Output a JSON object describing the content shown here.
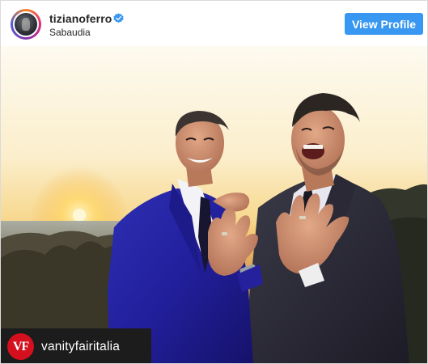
{
  "header": {
    "username": "tizianoferro",
    "location": "Sabaudia",
    "verified_icon": "verified-badge-icon",
    "view_profile_label": "View Profile"
  },
  "photo": {
    "overlay_account": "vanityfairitalia",
    "overlay_logo_text": "VF"
  },
  "colors": {
    "button_blue": "#3897f0",
    "verified_blue": "#3897f0",
    "vf_red": "#d40f1e",
    "text_dark": "#262626"
  }
}
